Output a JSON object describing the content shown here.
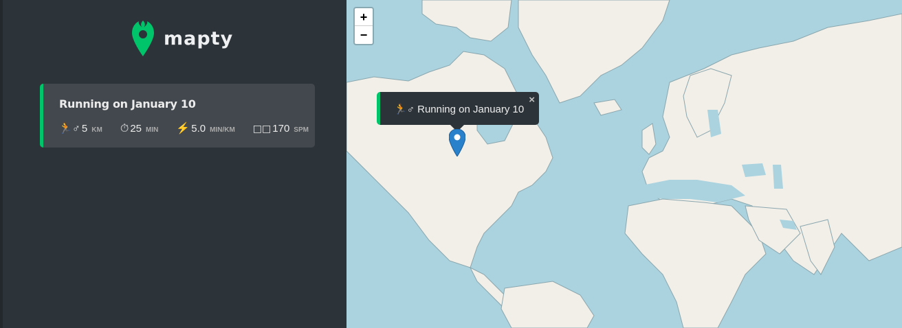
{
  "app": {
    "name": "mapty"
  },
  "workouts": [
    {
      "title": "Running on January 10",
      "details": [
        {
          "icon": "running-man-icon",
          "glyph": "🏃‍♂️",
          "value": "5",
          "unit": "km"
        },
        {
          "icon": "stopwatch-icon",
          "glyph": "⏱",
          "value": "25",
          "unit": "min"
        },
        {
          "icon": "lightning-icon",
          "glyph": "⚡️",
          "value": "5.0",
          "unit": "min/km"
        },
        {
          "icon": "footprints-icon",
          "glyph": "🦶🏼",
          "value": "170",
          "unit": "spm"
        }
      ]
    }
  ],
  "map": {
    "zoom_in_label": "+",
    "zoom_out_label": "−",
    "popup": {
      "text": "Running on January 10",
      "close_label": "×"
    }
  },
  "colors": {
    "accent": "#00c46a",
    "sidebar": "#2d3439",
    "card": "#42484d",
    "water": "#aad3df",
    "land": "#f2efe9"
  }
}
